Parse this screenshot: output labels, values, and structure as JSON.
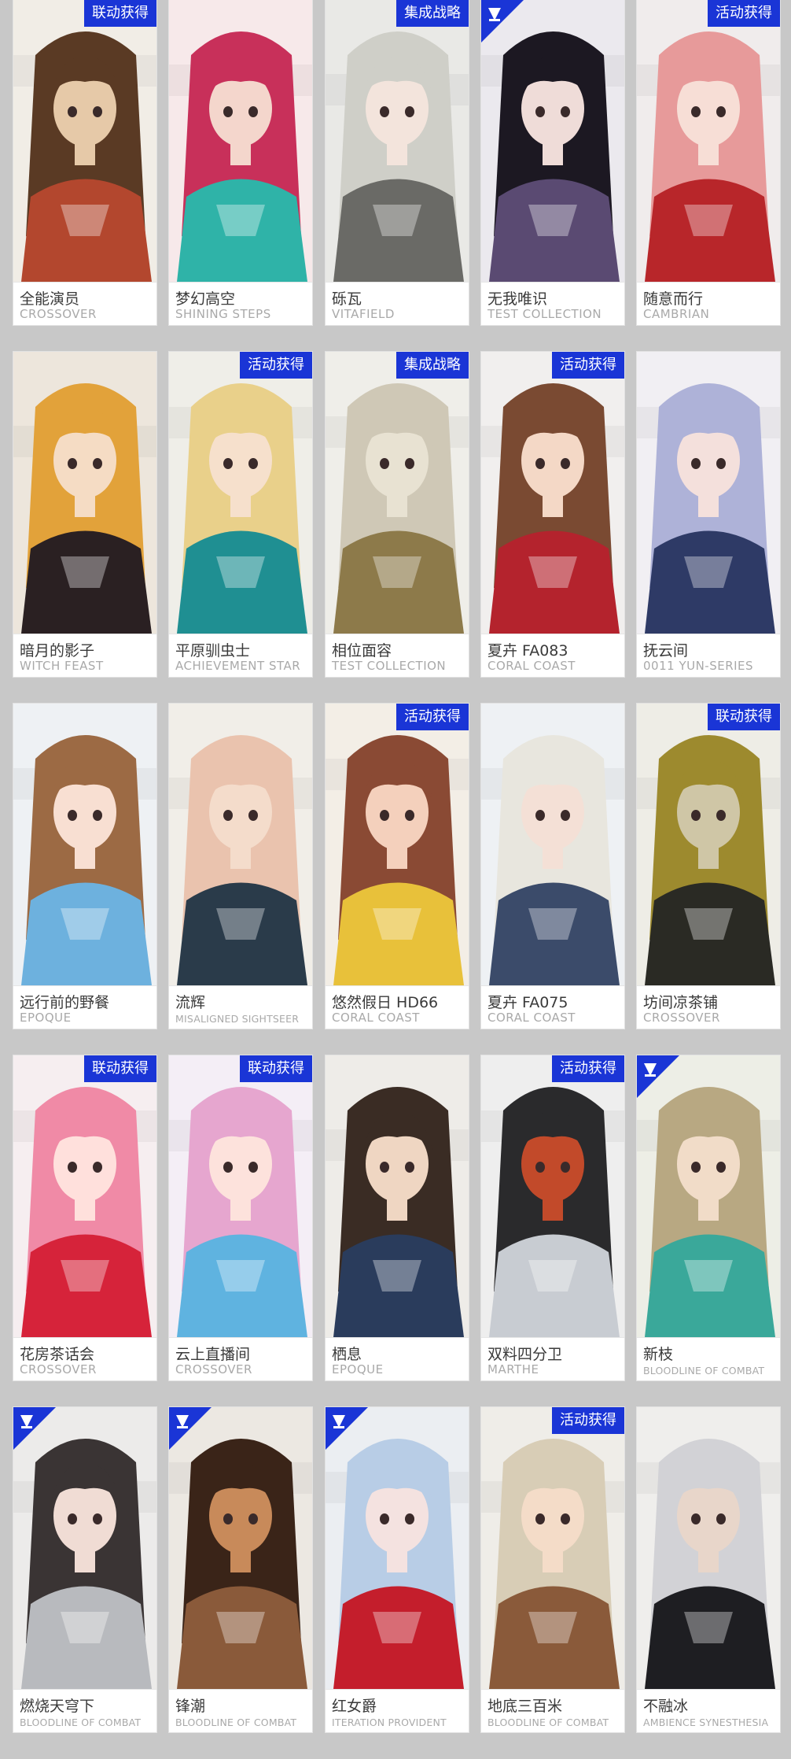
{
  "colors": {
    "background": "#c8c8c8",
    "badge": "#1a35d6",
    "title_text": "#3a3a3a",
    "subtitle_text": "#a9a9a9"
  },
  "skins": [
    {
      "name": "全能演员",
      "series": "CROSSOVER",
      "badge": "联动获得",
      "corner_icon": false,
      "palette": [
        "#f1ede6",
        "#5a3a24",
        "#b3472e",
        "#e6c9a8"
      ]
    },
    {
      "name": "梦幻高空",
      "series": "SHINING STEPS",
      "badge": "",
      "corner_icon": false,
      "palette": [
        "#f7e9ea",
        "#c8305a",
        "#2fb3a8",
        "#f4d6cc"
      ]
    },
    {
      "name": "砾瓦",
      "series": "VITAFIELD",
      "badge": "集成战略",
      "corner_icon": false,
      "palette": [
        "#e9e9e6",
        "#cfcfc8",
        "#6a6a66",
        "#f3e4dc"
      ]
    },
    {
      "name": "无我唯识",
      "series": "TEST COLLECTION",
      "badge": "",
      "corner_icon": true,
      "palette": [
        "#ebe9ee",
        "#1c1822",
        "#5a4a72",
        "#efdcd8"
      ]
    },
    {
      "name": "随意而行",
      "series": "CAMBRIAN",
      "badge": "活动获得",
      "corner_icon": false,
      "palette": [
        "#f0ecec",
        "#e79a9a",
        "#b8262a",
        "#f7ded6"
      ]
    },
    {
      "name": "暗月的影子",
      "series": "WITCH FEAST",
      "badge": "",
      "corner_icon": false,
      "palette": [
        "#ede6dc",
        "#e2a23a",
        "#2a2022",
        "#f5dcc4"
      ]
    },
    {
      "name": "平原驯虫士",
      "series": "ACHIEVEMENT STAR",
      "badge": "活动获得",
      "corner_icon": false,
      "palette": [
        "#efeee8",
        "#e9d08a",
        "#1f8f92",
        "#f6e0cc"
      ]
    },
    {
      "name": "相位面容",
      "series": "TEST COLLECTION",
      "badge": "集成战略",
      "corner_icon": false,
      "palette": [
        "#efeee9",
        "#cfc8b6",
        "#8d7a4a",
        "#e8e2d2"
      ]
    },
    {
      "name": "夏卉 FA083",
      "series": "CORAL COAST",
      "badge": "活动获得",
      "corner_icon": false,
      "palette": [
        "#f1efee",
        "#7a4a32",
        "#b4232d",
        "#f4d8c6"
      ]
    },
    {
      "name": "抚云间",
      "series": "0011 YUN-SERIES",
      "badge": "",
      "corner_icon": false,
      "palette": [
        "#f1eff3",
        "#aeb2d8",
        "#2e3a66",
        "#f4e0dc"
      ]
    },
    {
      "name": "远行前的野餐",
      "series": "EPOQUE",
      "badge": "",
      "corner_icon": false,
      "palette": [
        "#eef1f4",
        "#9c6a44",
        "#6db1de",
        "#f8dfd2"
      ]
    },
    {
      "name": "流辉",
      "series": "MISALIGNED SIGHTSEER",
      "badge": "",
      "corner_icon": false,
      "palette": [
        "#f1eee8",
        "#eac3ae",
        "#2a3b4a",
        "#f4dccb"
      ]
    },
    {
      "name": "悠然假日 HD66",
      "series": "CORAL COAST",
      "badge": "活动获得",
      "corner_icon": false,
      "palette": [
        "#f3eee6",
        "#8a4a34",
        "#e8c13a",
        "#f4d0bc"
      ]
    },
    {
      "name": "夏卉 FA075",
      "series": "CORAL COAST",
      "badge": "",
      "corner_icon": false,
      "palette": [
        "#eef1f4",
        "#e8e6de",
        "#3b4b6a",
        "#f4e0d6"
      ]
    },
    {
      "name": "坊间凉茶铺",
      "series": "CROSSOVER",
      "badge": "联动获得",
      "corner_icon": false,
      "palette": [
        "#eeede6",
        "#9d8a2e",
        "#2a2a24",
        "#cfc6a6"
      ]
    },
    {
      "name": "花房茶话会",
      "series": "CROSSOVER",
      "badge": "联动获得",
      "corner_icon": false,
      "palette": [
        "#f6eef0",
        "#f08aa6",
        "#d6233a",
        "#ffe0dc"
      ]
    },
    {
      "name": "云上直播间",
      "series": "CROSSOVER",
      "badge": "联动获得",
      "corner_icon": false,
      "palette": [
        "#f4eef6",
        "#e6a6cf",
        "#5fb3e0",
        "#fde2dc"
      ]
    },
    {
      "name": "栖息",
      "series": "EPOQUE",
      "badge": "",
      "corner_icon": false,
      "palette": [
        "#eeece8",
        "#3a2c24",
        "#2a3c5c",
        "#efd6c2"
      ]
    },
    {
      "name": "双料四分卫",
      "series": "MARTHE",
      "badge": "活动获得",
      "corner_icon": false,
      "palette": [
        "#eeeeee",
        "#2a2a2c",
        "#c8ccd2",
        "#c24a2a"
      ]
    },
    {
      "name": "新枝",
      "series": "BLOODLINE OF COMBAT",
      "badge": "",
      "corner_icon": true,
      "palette": [
        "#edeee6",
        "#b8a882",
        "#3aa89a",
        "#f1dcc8"
      ]
    },
    {
      "name": "燃烧天穹下",
      "series": "BLOODLINE OF COMBAT",
      "badge": "",
      "corner_icon": true,
      "palette": [
        "#ecebea",
        "#3a3434",
        "#b8babe",
        "#f0dcd4"
      ]
    },
    {
      "name": "锋潮",
      "series": "BLOODLINE OF COMBAT",
      "badge": "",
      "corner_icon": true,
      "palette": [
        "#ece8e2",
        "#3a2418",
        "#8a5a3a",
        "#c88a5a"
      ]
    },
    {
      "name": "红女爵",
      "series": "ITERATION PROVIDENT",
      "badge": "",
      "corner_icon": true,
      "palette": [
        "#ebeef2",
        "#b8cde6",
        "#c41e2c",
        "#f4e2e0"
      ]
    },
    {
      "name": "地底三百米",
      "series": "BLOODLINE OF COMBAT",
      "badge": "活动获得",
      "corner_icon": false,
      "palette": [
        "#efede8",
        "#d8cdb6",
        "#8a5a3a",
        "#f4dcc8"
      ]
    },
    {
      "name": "不融冰",
      "series": "AMBIENCE SYNESTHESIA",
      "badge": "",
      "corner_icon": false,
      "palette": [
        "#efeeec",
        "#d2d2d6",
        "#1e1e22",
        "#e8d6ca"
      ]
    }
  ]
}
